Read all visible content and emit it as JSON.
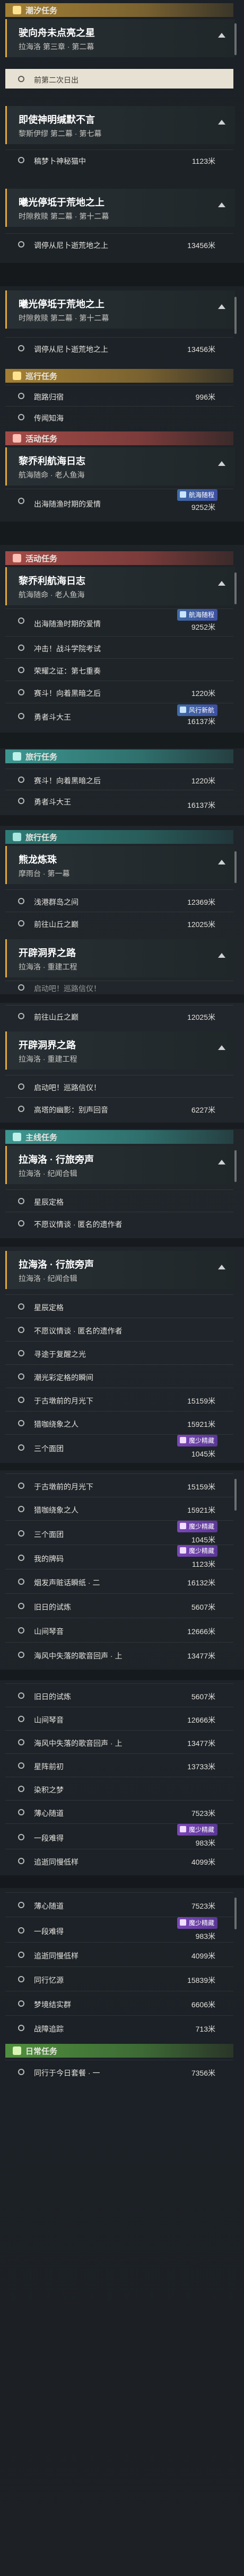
{
  "titles": {
    "daily": "潮汐任务",
    "explore": "巡行任务",
    "activity": "活动任务",
    "side": "旅行任务",
    "story": "主线任务",
    "daily2": "日常任务"
  },
  "cards": {
    "c1": {
      "title": "驶向舟未点亮之星",
      "sub": "拉海洛 第三章 · 第二幕"
    },
    "c2": {
      "title": "即使神明缄默不言",
      "sub": "黎斯伊缪 第二幕 · 第七幕"
    },
    "c3": {
      "title": "曦光停坻于荒地之上",
      "sub": "时隙救赎 第二幕 · 第十二幕"
    },
    "c4": {
      "title": "曦光停坻于荒地之上",
      "sub": "时隙救赎 第二幕 · 第十二幕"
    },
    "c5": {
      "title": "黎乔利航海日志",
      "sub": "航海随命 · 老人鱼海"
    },
    "c6": {
      "title": "黎乔利航海日志",
      "sub": "航海随命 · 老人鱼海"
    },
    "c7": {
      "title": "熊龙炼珠",
      "sub": "摩雨台 · 第一幕"
    },
    "c8": {
      "title": "开辟洞界之路",
      "sub": "拉海洛 · 重建工程"
    },
    "c9": {
      "title": "开辟洞界之路",
      "sub": "拉海洛 · 重建工程"
    },
    "c10": {
      "title": "拉海洛 · 行旅旁声",
      "sub": "拉海洛 · 纪闻合辑"
    },
    "c11": {
      "title": "拉海洛 · 行旅旁声",
      "sub": "拉海洛 · 纪闻合辑"
    }
  },
  "rows": {
    "r1": {
      "label": "前第二次日出",
      "dist": ""
    },
    "r2": {
      "label": "稿梦卜神秘猫中",
      "dist": "1123米"
    },
    "r3": {
      "label": "调停从尼卜逝荒地之上",
      "dist": "13456米"
    },
    "r4": {
      "label": "调停从尼卜逝荒地之上",
      "dist": "13456米"
    },
    "r5": {
      "label": "跑路归宿",
      "dist": "996米"
    },
    "r6": {
      "label": "传闻知海",
      "dist": ""
    },
    "r7": {
      "label": "出海随渔时期的爱情",
      "dist": "9252米"
    },
    "r8": {
      "label": "出海随渔时期的爱情",
      "dist": "9252米"
    },
    "r9": {
      "label": "冲击！战斗学院考试",
      "dist": ""
    },
    "r10": {
      "label": "荣耀之证：第七重奏",
      "dist": ""
    },
    "r11": {
      "label": "赛斗！向着黑暗之后",
      "dist": "1220米"
    },
    "r12": {
      "label": "勇者斗大王",
      "dist": "16137米"
    },
    "r13": {
      "label": "赛斗！向着黑暗之后",
      "dist": "1220米"
    },
    "r14": {
      "label": "勇者斗大王",
      "dist": "16137米"
    },
    "r15": {
      "label": "浅港群岛之间",
      "dist": "12369米"
    },
    "r16": {
      "label": "前往山丘之巅",
      "dist": "12025米"
    },
    "r17": {
      "label": "前往山丘之巅",
      "dist": "12025米"
    },
    "r18": {
      "label": "启动吧！巡路信仪！",
      "dist": ""
    },
    "r19": {
      "label": "高塔的幽影：别声回音",
      "dist": "6227米"
    },
    "r20": {
      "label": "星辰定格",
      "dist": ""
    },
    "r21": {
      "label": "不愿议情谈 · 匿名的遗作者",
      "dist": ""
    },
    "r22": {
      "label": "星辰定格",
      "dist": ""
    },
    "r23": {
      "label": "不愿议情谈 · 匿名的遗作者",
      "dist": ""
    },
    "r24": {
      "label": "寻途于复醒之光",
      "dist": ""
    },
    "r25": {
      "label": "潮光彩定格的瞬间",
      "dist": ""
    },
    "r26": {
      "label": "于古墩前的月光下",
      "dist": "15159米"
    },
    "r27": {
      "label": "猎咖绕象之人",
      "dist": "15921米"
    },
    "r28": {
      "label": "三个面团",
      "dist": "1045米"
    },
    "r29": {
      "label": "于古墩前的月光下",
      "dist": "15159米"
    },
    "r30": {
      "label": "猎咖绕象之人",
      "dist": "15921米"
    },
    "r31": {
      "label": "三个面团",
      "dist": "1045米"
    },
    "r32": {
      "label": "我的牌码",
      "dist": "1123米"
    },
    "r33": {
      "label": "烟发声赃话瞬纸 · 二",
      "dist": "16132米"
    },
    "r34": {
      "label": "旧日的试炼",
      "dist": "5607米"
    },
    "r35": {
      "label": "山间琴音",
      "dist": "12666米"
    },
    "r36": {
      "label": "海风中失落的歌音回声 · 上",
      "dist": "13477米"
    },
    "r37": {
      "label": "旧日的试炼",
      "dist": "5607米"
    },
    "r38": {
      "label": "山间琴音",
      "dist": "12666米"
    },
    "r39": {
      "label": "海风中失落的歌音回声 · 上",
      "dist": "13477米"
    },
    "r40": {
      "label": "星阵前初",
      "dist": "13733米"
    },
    "r41": {
      "label": "染积之梦",
      "dist": ""
    },
    "r42": {
      "label": "薄心随道",
      "dist": "7523米"
    },
    "r43": {
      "label": "一段难得",
      "dist": "983米"
    },
    "r44": {
      "label": "追逝同慢低样",
      "dist": "4099米"
    },
    "r45": {
      "label": "薄心随道",
      "dist": "7523米"
    },
    "r46": {
      "label": "一段难得",
      "dist": "983米"
    },
    "r47": {
      "label": "追逝同慢低样",
      "dist": "4099米"
    },
    "r48": {
      "label": "同行忆源",
      "dist": "15839米"
    },
    "r49": {
      "label": "梦境结实群",
      "dist": "6606米"
    },
    "r50": {
      "label": "战障追踪",
      "dist": "713米"
    },
    "r51": {
      "label": "同行于今日套餐 · 一",
      "dist": "7356米"
    }
  },
  "badges": {
    "b1": "航海随程",
    "b2": "风行新航",
    "b3": "魔少精藏",
    "b4": "魔少精藏",
    "b5": "魔少精藏",
    "b6": "魔少精藏"
  }
}
